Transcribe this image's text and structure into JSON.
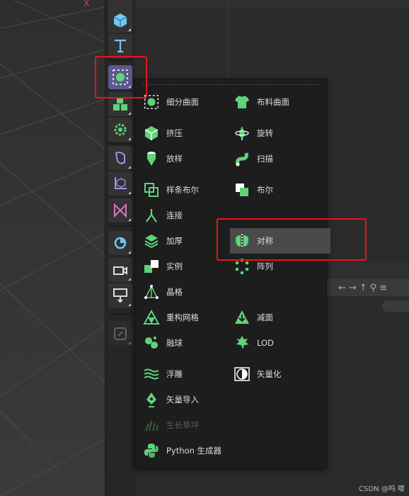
{
  "viewport": {
    "axis_label": "X"
  },
  "menu": {
    "col1": [
      {
        "label": "细分曲面",
        "icon": "subdivision-surface-icon"
      },
      {
        "label": "挤压",
        "icon": "extrude-icon"
      },
      {
        "label": "放样",
        "icon": "loft-icon"
      },
      {
        "label": "样条布尔",
        "icon": "spline-boolean-icon"
      },
      {
        "label": "连接",
        "icon": "connect-icon"
      },
      {
        "label": "加厚",
        "icon": "thicken-icon"
      },
      {
        "label": "实例",
        "icon": "instance-icon"
      },
      {
        "label": "晶格",
        "icon": "lattice-icon"
      },
      {
        "label": "重构网格",
        "icon": "remesh-icon"
      },
      {
        "label": "融球",
        "icon": "metaball-icon"
      },
      {
        "label": "浮雕",
        "icon": "relief-icon"
      },
      {
        "label": "矢量导入",
        "icon": "vector-import-icon"
      },
      {
        "label": "生长草坪",
        "icon": "grass-icon"
      },
      {
        "label": "Python 生成器",
        "icon": "python-icon"
      }
    ],
    "col2": [
      {
        "label": "布料曲面",
        "icon": "cloth-surface-icon"
      },
      {
        "label": "旋转",
        "icon": "lathe-icon"
      },
      {
        "label": "扫描",
        "icon": "sweep-icon"
      },
      {
        "label": "布尔",
        "icon": "boolean-icon"
      },
      {
        "label": "对称",
        "icon": "symmetry-icon"
      },
      {
        "label": "阵列",
        "icon": "array-icon"
      },
      {
        "label": "减面",
        "icon": "polygon-reduction-icon"
      },
      {
        "label": "LOD",
        "icon": "lod-icon"
      },
      {
        "label": "矢量化",
        "icon": "tracer-icon"
      }
    ]
  },
  "colors": {
    "icon_green": "#5fd37a",
    "highlight": "#4a4a4a",
    "annotation": "#e8141e",
    "toolbar_active": "#5b5b8f"
  },
  "watermark": "CSDN @吗 喽"
}
